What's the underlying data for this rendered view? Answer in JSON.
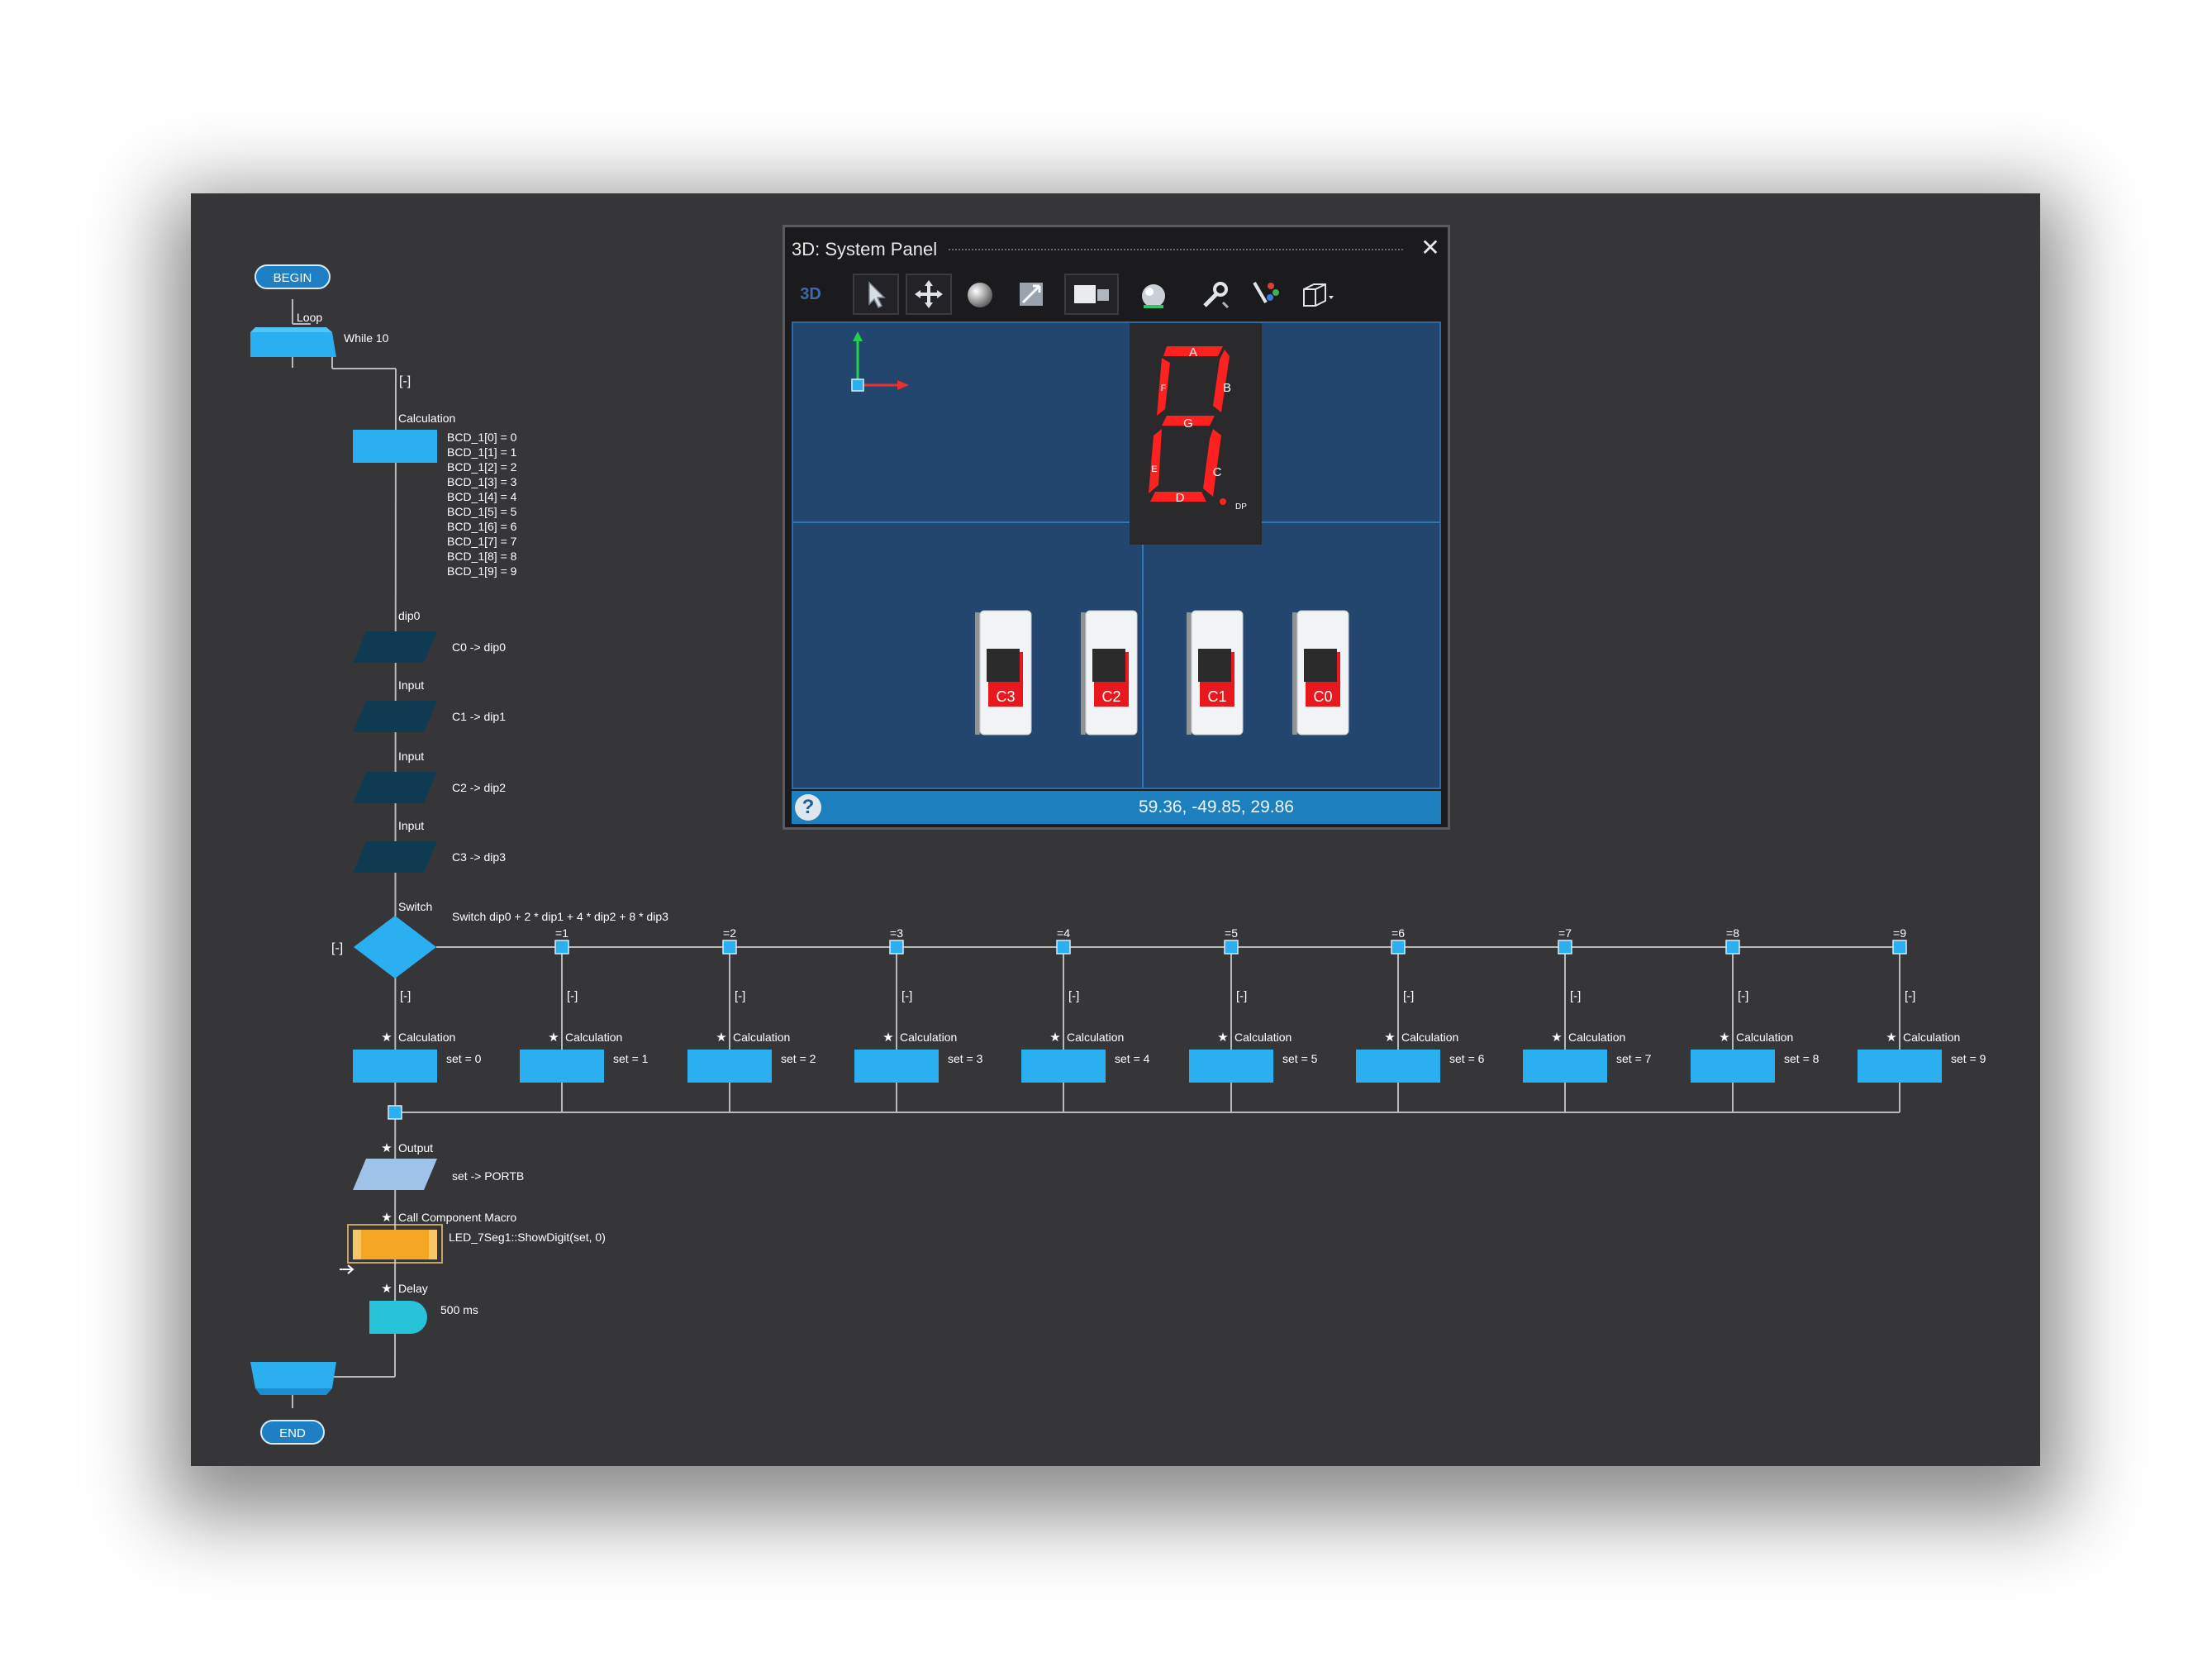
{
  "flowchart": {
    "begin": "BEGIN",
    "end": "END",
    "loop_label": "Loop",
    "loop_condition": "While 10",
    "collapse": "[-]",
    "calc_label": "Calculation",
    "bcd_lines": [
      "BCD_1[0] = 0",
      "BCD_1[1] = 1",
      "BCD_1[2] = 2",
      "BCD_1[3] = 3",
      "BCD_1[4] = 4",
      "BCD_1[5] = 5",
      "BCD_1[6] = 6",
      "BCD_1[7] = 7",
      "BCD_1[8] = 8",
      "BCD_1[9] = 9"
    ],
    "inputs": [
      {
        "label": "dip0",
        "text": "C0 -> dip0"
      },
      {
        "label": "Input",
        "text": "C1 -> dip1"
      },
      {
        "label": "Input",
        "text": "C2 -> dip2"
      },
      {
        "label": "Input",
        "text": "C3 -> dip3"
      }
    ],
    "switch_label": "Switch",
    "switch_expr": "Switch dip0 + 2 * dip1 + 4 * dip2 + 8 * dip3",
    "cases": [
      {
        "case": "",
        "set": "set = 0"
      },
      {
        "case": "=1",
        "set": "set = 1"
      },
      {
        "case": "=2",
        "set": "set = 2"
      },
      {
        "case": "=3",
        "set": "set = 3"
      },
      {
        "case": "=4",
        "set": "set = 4"
      },
      {
        "case": "=5",
        "set": "set = 5"
      },
      {
        "case": "=6",
        "set": "set = 6"
      },
      {
        "case": "=7",
        "set": "set = 7"
      },
      {
        "case": "=8",
        "set": "set = 8"
      },
      {
        "case": "=9",
        "set": "set = 9"
      }
    ],
    "output_label": "Output",
    "output_text": "set -> PORTB",
    "macro_label": "Call Component Macro",
    "macro_text": "LED_7Seg1::ShowDigit(set, 0)",
    "delay_label": "Delay",
    "delay_text": "500 ms"
  },
  "panel": {
    "title": "3D: System Panel",
    "close": "✕",
    "toolbar_mode": "3D",
    "toolbar_icons": [
      "select-arrow-icon",
      "pan-icon",
      "sphere-icon",
      "zoom-icon",
      "camera-icon",
      "light-icon",
      "wrench-icon",
      "color-icon",
      "cube-view-icon"
    ],
    "segments": {
      "a": "A",
      "b": "B",
      "c": "C",
      "d": "D",
      "e": "E",
      "f": "F",
      "g": "G",
      "dp": "DP"
    },
    "switches": [
      "C3",
      "C2",
      "C1",
      "C0"
    ],
    "help": "?",
    "coordinates": "59.36, -49.85, 29.86"
  },
  "colors": {
    "background": "#363639",
    "block_blue": "#2ab0f0",
    "input_dark": "#0f3b52",
    "output_light": "#9fc2e8",
    "macro_orange": "#f5a623",
    "delay_cyan": "#26c3d9",
    "viewport": "#23466f",
    "segment_red": "#ff2020"
  }
}
